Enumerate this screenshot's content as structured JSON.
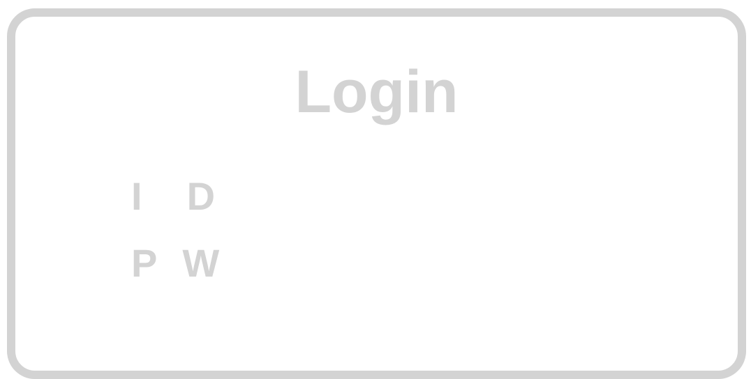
{
  "login": {
    "title": "Login",
    "id_label_chars": [
      "I",
      "D"
    ],
    "pw_label_chars": [
      "P",
      "W"
    ],
    "id_value": "",
    "pw_value": ""
  },
  "colors": {
    "border": "#d3d3d3",
    "text": "#d3d3d3",
    "background": "#ffffff"
  }
}
